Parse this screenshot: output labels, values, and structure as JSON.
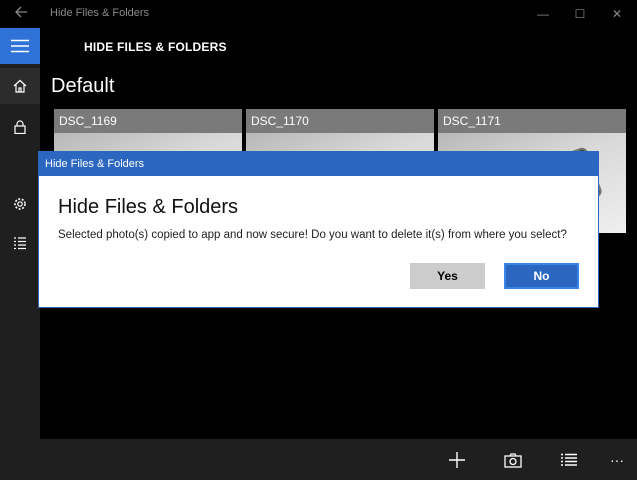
{
  "window": {
    "title": "Hide Files & Folders",
    "controls": {
      "back_icon": "back-arrow-icon",
      "minimize": "—",
      "maximize": "☐",
      "close": "✕"
    }
  },
  "rail": {
    "items": [
      {
        "icon": "hamburger-menu-icon",
        "active": true
      },
      {
        "icon": "home-icon",
        "selected": true
      },
      {
        "icon": "lock-icon"
      },
      {
        "icon": "gear-icon"
      },
      {
        "icon": "list-icon"
      }
    ]
  },
  "header": {
    "app_name": "HIDE FILES & FOLDERS",
    "section_title": "Default"
  },
  "photos": [
    {
      "name": "DSC_1169"
    },
    {
      "name": "DSC_1170"
    },
    {
      "name": "DSC_1171"
    }
  ],
  "appbar": {
    "add_icon": "plus-icon",
    "camera_icon": "camera-icon",
    "select_icon": "select-list-icon",
    "more_label": "···"
  },
  "dialog": {
    "titlebar": "Hide Files & Folders",
    "heading": "Hide Files & Folders",
    "message": "Selected photo(s) copied to app and now secure! Do you want to delete it(s) from where you select?",
    "yes_label": "Yes",
    "no_label": "No"
  },
  "colors": {
    "accent": "#2b67c1",
    "rail_active": "#2f73d8",
    "background": "#000000",
    "rail": "#1f1f1f",
    "button_secondary": "#cccccc"
  }
}
